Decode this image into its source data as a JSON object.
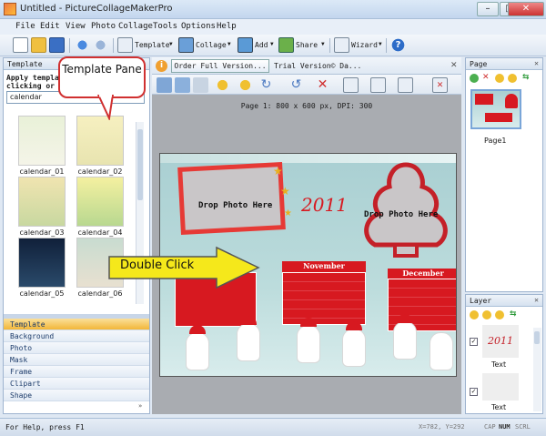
{
  "window": {
    "title": "Untitled - PictureCollageMakerPro"
  },
  "menu": [
    "File",
    "Edit",
    "View",
    "Photo",
    "Collage",
    "Tools",
    "Options",
    "Help"
  ],
  "toolbar": {
    "template_label": "Template",
    "collage_label": "Collage",
    "add_label": "Add",
    "share_label": "Share",
    "wizard_label": "Wizard"
  },
  "template_panel": {
    "title": "Template",
    "apply_text": "Apply template",
    "apply_text2": "clicking or d",
    "category_value": "calendar",
    "thumbnails": [
      "calendar_01",
      "calendar_02",
      "calendar_03",
      "calendar_04",
      "calendar_05",
      "calendar_06"
    ],
    "categories": [
      "Template",
      "Background",
      "Photo",
      "Mask",
      "Frame",
      "Clipart",
      "Shape"
    ]
  },
  "callouts": {
    "template_pane": "Template Pane",
    "double_click": "Double Click"
  },
  "canvas": {
    "order_button": "Order Full Version...",
    "trial_text": "Trial Version© Da...",
    "page_info": "Page 1: 800 x 600 px, DPI: 300",
    "drop_photo_1": "Drop Photo Here",
    "drop_photo_2": "Drop Photo Here",
    "year": "2011",
    "month_1": "November",
    "month_2": "December"
  },
  "page_panel": {
    "title": "Page",
    "page_label": "Page1"
  },
  "layer_panel": {
    "title": "Layer",
    "item_1_label": "Text",
    "item_2_label": "Text",
    "item_1_preview": "2011"
  },
  "status": {
    "help": "For Help, press F1",
    "coords": "X=782, Y=292",
    "cap": "CAP",
    "num": "NUM",
    "scrl": "SCRL"
  },
  "colors": {
    "accent_red": "#d71920",
    "callout_yellow": "#f5e81b",
    "selected_tab": "#f7c94c",
    "canvas_bg": "#a9acb1"
  }
}
